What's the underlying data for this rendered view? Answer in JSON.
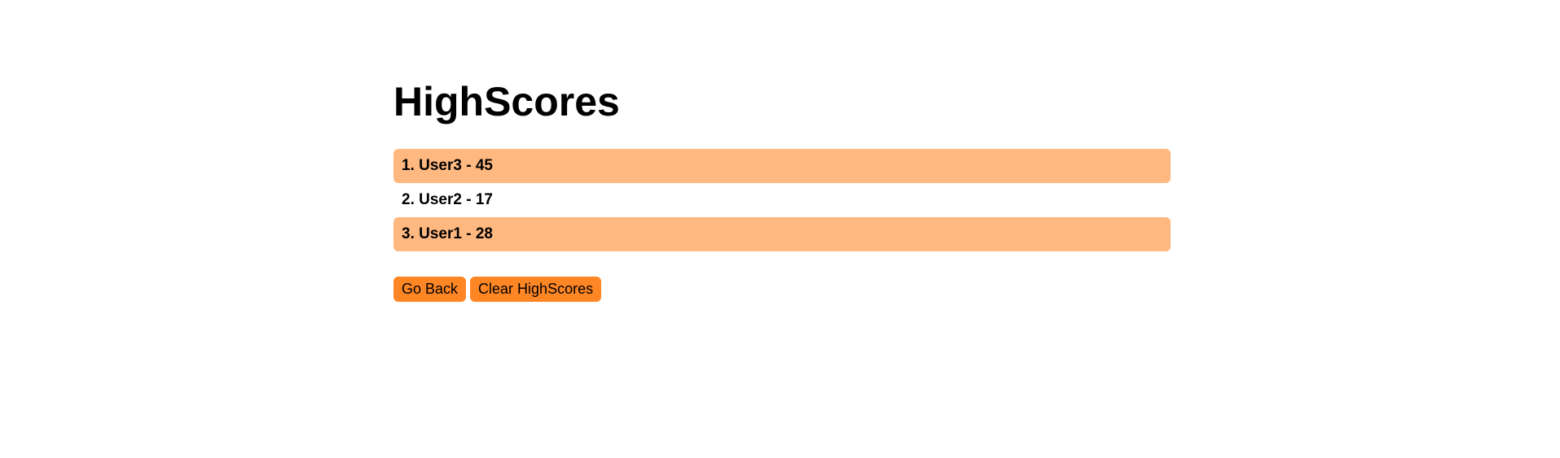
{
  "title": "HighScores",
  "scores": [
    {
      "text": "1. User3 - 45",
      "highlight": true
    },
    {
      "text": "2. User2 - 17",
      "highlight": false
    },
    {
      "text": "3. User1 - 28",
      "highlight": true
    }
  ],
  "buttons": {
    "go_back": "Go Back",
    "clear": "Clear HighScores"
  },
  "colors": {
    "row_highlight": "#ffb880",
    "button": "#ff8624"
  }
}
